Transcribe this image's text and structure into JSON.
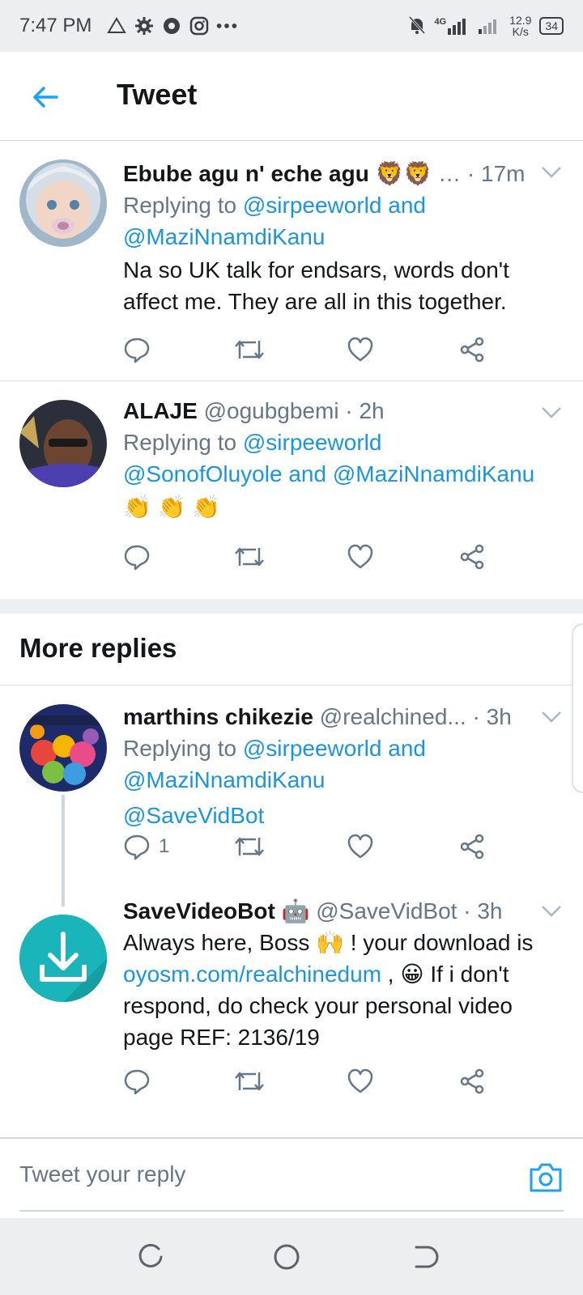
{
  "status_bar": {
    "time": "7:47 PM",
    "network_type": "4G",
    "speed_value": "12.9",
    "speed_unit": "K/s",
    "battery": "34"
  },
  "header": {
    "title": "Tweet"
  },
  "tweets": [
    {
      "name": "Ebube agu n' eche agu",
      "name_emoji": "🦁🦁",
      "handle": "…",
      "time": "· 17m",
      "reply_prefix": "Replying to ",
      "reply_line1_mention": "@sirpeeworld",
      "reply_line1_rest": " and",
      "reply_line2": "@MaziNnamdiKanu",
      "text_lines": [
        "Na so UK talk for endsars, words don't",
        "affect me. They are all in this together."
      ]
    },
    {
      "name": "ALAJE",
      "handle": "@ogubgbemi",
      "time": "· 2h",
      "reply_prefix": "Replying to ",
      "reply_line1_mention": "@sirpeeworld",
      "reply_line2_a": "@SonofOluyole",
      "reply_line2_and": " and ",
      "reply_line2_b": "@MaziNnamdiKanu",
      "text": "👏 👏 👏"
    }
  ],
  "more_replies": {
    "title": "More replies"
  },
  "more_tweets": [
    {
      "name": "marthins chikezie",
      "handle": "@realchined...",
      "time": "· 3h",
      "reply_prefix": "Replying to ",
      "reply_line1_mention": "@sirpeeworld",
      "reply_line1_rest": " and",
      "reply_line2": "@MaziNnamdiKanu",
      "text_mention": "@SaveVidBot",
      "reply_count": "1"
    },
    {
      "name": "SaveVideoBot",
      "name_emoji": "🤖",
      "handle": "@SaveVidBot",
      "time": "· 3h",
      "line1": "Always here, Boss 🙌 ! your download is",
      "link": "oyosm.com/realchinedum",
      "line2_rest": " ,  😀 If i don't",
      "line3": "respond, do check your personal video",
      "line4": "page REF: 2136/19"
    }
  ],
  "reply_bar": {
    "placeholder": "Tweet your reply"
  },
  "colors": {
    "accent": "#1da1f2",
    "mention": "#1b95e0",
    "muted": "#657786",
    "text": "#14171a",
    "divider": "#d8dde1"
  }
}
